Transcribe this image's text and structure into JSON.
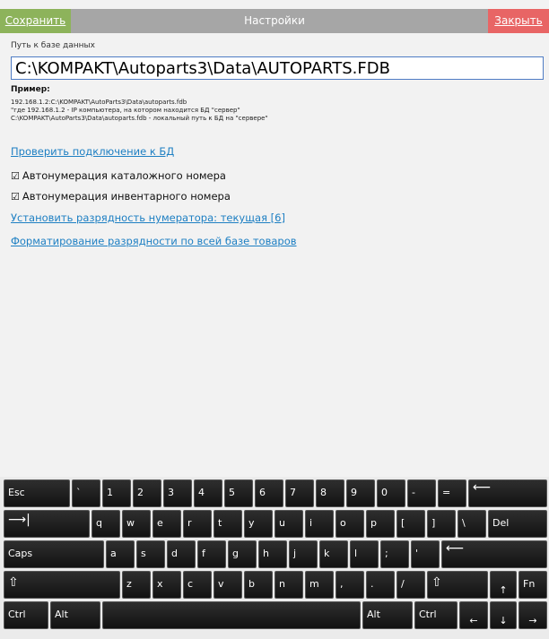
{
  "titlebar": {
    "save": "Сохранить",
    "title": "Настройки",
    "close": "Закрыть"
  },
  "db": {
    "label": "Путь к базе данных",
    "path": "C:\\KOMPAKT\\Autoparts3\\Data\\AUTOPARTS.FDB",
    "example_title": "Пример:",
    "example_lines": [
      "192.168.1.2:C:\\KOMPAKT\\AutoParts3\\Data\\autoparts.fdb",
      "\"где 192.168.1.2 - IP компьютера, на котором находится БД \"сервер\"",
      "C:\\KOMPAKT\\AutoParts3\\Data\\autoparts.fdb - локальный путь к БД на \"сервере\""
    ]
  },
  "actions": {
    "check_connection": "Проверить подключение к БД",
    "auto_catalog": "Автонумерация каталожного номера",
    "auto_inventory": "Автонумерация инвентарного номера",
    "set_digits": "Установить разрядность нумератора: текущая [6]",
    "format_digits": "Форматирование разрядности по всей базе товаров"
  },
  "checkbox_mark": "☑",
  "keyboard": {
    "row1": [
      "Esc",
      "`",
      "1",
      "2",
      "3",
      "4",
      "5",
      "6",
      "7",
      "8",
      "9",
      "0",
      "-",
      "=",
      "⟵"
    ],
    "row2": [
      "⟶|",
      "q",
      "w",
      "e",
      "r",
      "t",
      "y",
      "u",
      "i",
      "o",
      "p",
      "[",
      "]",
      "\\",
      "Del"
    ],
    "row3": [
      "Caps",
      "a",
      "s",
      "d",
      "f",
      "g",
      "h",
      "j",
      "k",
      "l",
      ";",
      "'",
      "⟵"
    ],
    "row4": [
      "⇧",
      "z",
      "x",
      "c",
      "v",
      "b",
      "n",
      "m",
      ",",
      ".",
      "/",
      "⇧",
      "↑",
      "Fn"
    ],
    "row5": [
      "Ctrl",
      "Alt",
      "",
      "Alt",
      "Ctrl",
      "←",
      "↓",
      "→"
    ]
  },
  "colors": {
    "save": "#8db35b",
    "close": "#e86565",
    "titlebar": "#a6a6a6",
    "link": "#1d7fc3"
  }
}
